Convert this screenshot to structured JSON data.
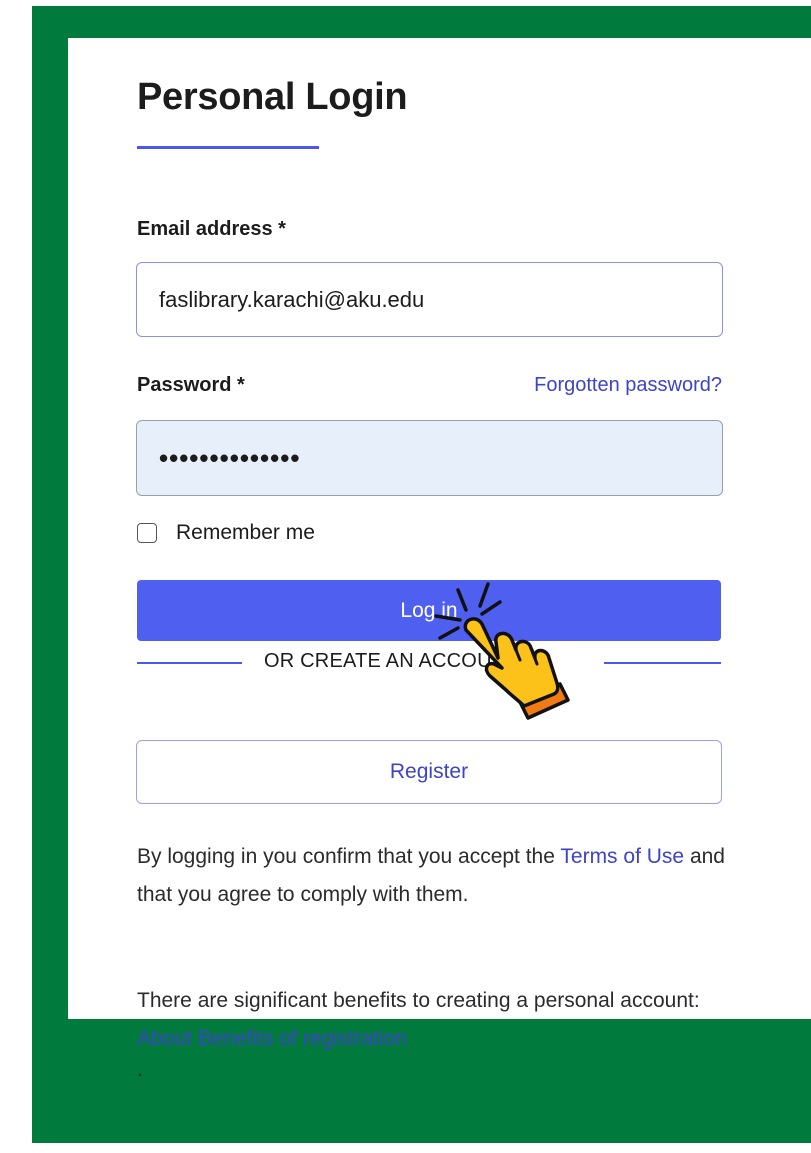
{
  "page": {
    "frame_color": "#007a3d",
    "accent_color": "#4f60f0",
    "link_color": "#3d44c8"
  },
  "login": {
    "title": "Personal Login",
    "email_label": "Email address *",
    "email_value": "faslibrary.karachi@aku.edu",
    "password_label": "Password *",
    "forgot_link": "Forgotten password?",
    "password_value": "••••••••••••••",
    "remember_label": "Remember me",
    "remember_checked": false,
    "login_button": "Log in",
    "divider_text": "OR CREATE AN ACCOUNT",
    "register_button": "Register"
  },
  "footer": {
    "terms_prefix": "By logging in you confirm that you accept the",
    "terms_link": "Terms of Use",
    "terms_suffix": "and that you agree to comply with them.",
    "benefits_prefix": "There are significant benefits to creating a personal account:",
    "benefits_link": "About Benefits of registration",
    "trailing": "."
  },
  "overlay": {
    "cursor_icon": "pointing-hand-click-icon"
  }
}
